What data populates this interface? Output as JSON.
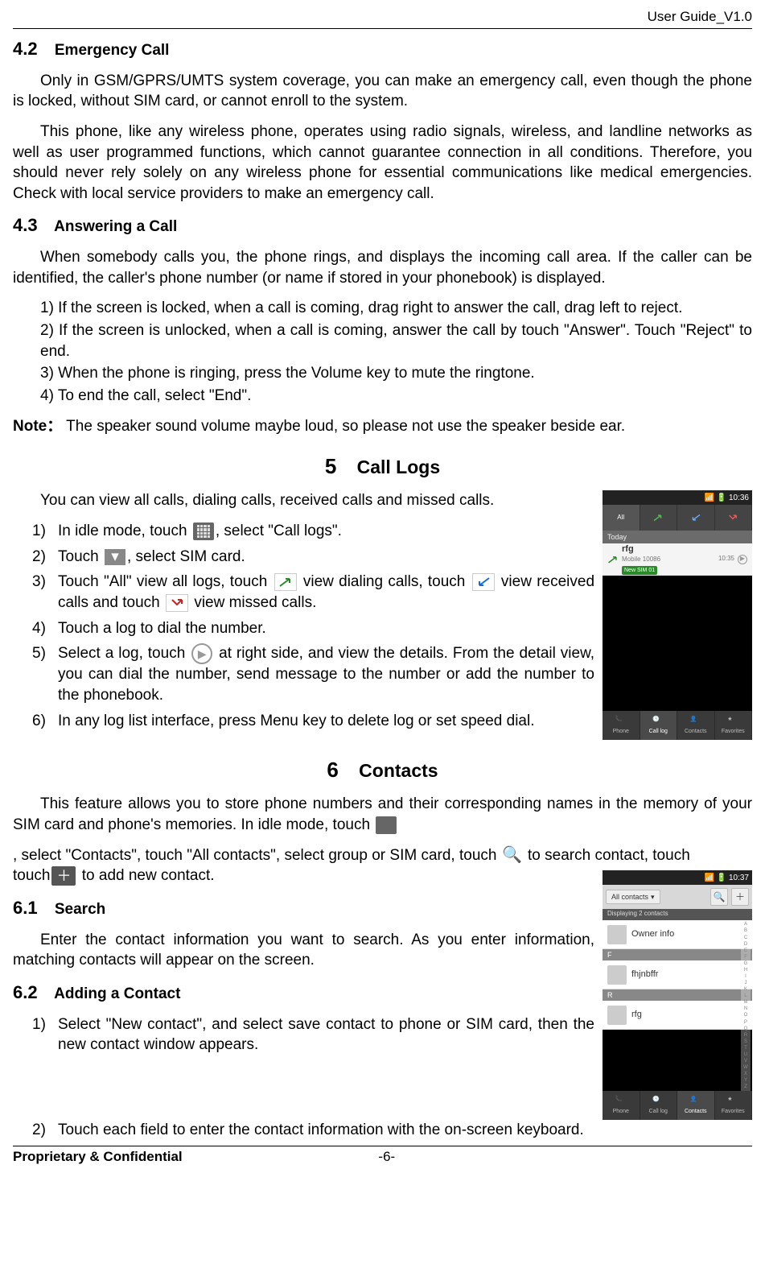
{
  "header": {
    "doc_version": "User Guide_V1.0"
  },
  "sec_4_2": {
    "num": "4.2",
    "title": "Emergency Call",
    "p1": "Only in GSM/GPRS/UMTS system coverage, you can make an emergency call, even though the phone is locked, without SIM card, or cannot enroll to the system.",
    "p2": "This phone, like any wireless phone, operates using radio signals, wireless, and landline networks as well as user programmed functions, which cannot guarantee connection in all conditions. Therefore, you should never rely solely on any wireless phone for essential communications like medical emergencies. Check with local service providers to make an emergency call."
  },
  "sec_4_3": {
    "num": "4.3",
    "title": "Answering a Call",
    "intro": "When somebody calls you, the phone rings, and displays the incoming call area. If the caller can be identified, the caller's phone number (or name if stored in your phonebook) is displayed.",
    "items": [
      "1)  If the screen is locked, when a call is coming, drag right to answer the call, drag left to reject.",
      "2)  If the screen is unlocked, when a call is coming, answer the call by touch \"Answer\". Touch \"Reject\" to end.",
      "3)  When the phone is ringing, press the Volume key to mute the ringtone.",
      "4)  To end the call, select \"End\"."
    ],
    "note_label": "Note：",
    "note_text": "The speaker sound volume maybe loud, so please not use the speaker beside ear."
  },
  "chap_5": {
    "num": "5",
    "title": "Call Logs",
    "intro": "You can view all calls, dialing calls, received calls and missed calls.",
    "items": {
      "1_pre": "In idle mode, touch",
      "1_post": ", select \"Call logs\".",
      "2_pre": "Touch",
      "2_post": ", select SIM card.",
      "3_a": "Touch \"All\" view all logs, touch ",
      "3_b": " view dialing calls, touch ",
      "3_c": " view received calls and touch ",
      "3_d": " view missed calls.",
      "4": "Touch a log to dial the number.",
      "5_pre": "Select a log, touch",
      "5_post": " at right side, and view the details. From the detail view, you can dial the number, send message to the number or add the number to the phonebook.",
      "6": "In any log list interface, press Menu key to delete log or set speed dial."
    },
    "screenshot": {
      "time": "10:36",
      "tabs": [
        "All",
        "",
        "",
        ""
      ],
      "today": "Today",
      "log_name": "rfg",
      "log_sub": "Mobile 10086",
      "log_sim": "New SIM 01",
      "log_time": "10:35",
      "bottom_tabs": [
        "Phone",
        "Call log",
        "Contacts",
        "Favorites"
      ]
    }
  },
  "chap_6": {
    "num": "6",
    "title": "Contacts",
    "intro_a": "This feature allows you to store phone numbers and their corresponding names in the memory of your SIM card and phone's memories. In idle mode, touch",
    "intro_b": ", select \"Contacts\", touch \"All contacts\", select group or SIM card, touch",
    "intro_c": " to search contact, touch",
    "intro_d": " to add new contact.",
    "sec_6_1": {
      "num": "6.1",
      "title": "Search",
      "p": "Enter the contact information you want to search. As you enter information, matching contacts will appear on the screen."
    },
    "sec_6_2": {
      "num": "6.2",
      "title": "Adding a Contact",
      "items": [
        "Select \"New contact\", and select save contact to phone or SIM card, then the new contact window appears.",
        "Touch each field to enter the contact information with the on-screen keyboard."
      ]
    },
    "screenshot": {
      "time": "10:37",
      "all_contacts": "All contacts",
      "displaying": "Displaying 2 contacts",
      "rows": [
        {
          "name": "Owner info"
        },
        {
          "sep": "F"
        },
        {
          "name": "fhjnbffr"
        },
        {
          "sep": "R"
        },
        {
          "name": "rfg"
        }
      ],
      "index": [
        "A",
        "B",
        "C",
        "D",
        "E",
        "F",
        "G",
        "H",
        "I",
        "J",
        "K",
        "L",
        "M",
        "N",
        "O",
        "P",
        "Q",
        "R",
        "S",
        "T",
        "U",
        "V",
        "W",
        "X",
        "Y",
        "Z"
      ],
      "bottom_tabs": [
        "Phone",
        "Call log",
        "Contacts",
        "Favorites"
      ]
    }
  },
  "footer": {
    "left": "Proprietary & Confidential",
    "page": "-6-"
  }
}
